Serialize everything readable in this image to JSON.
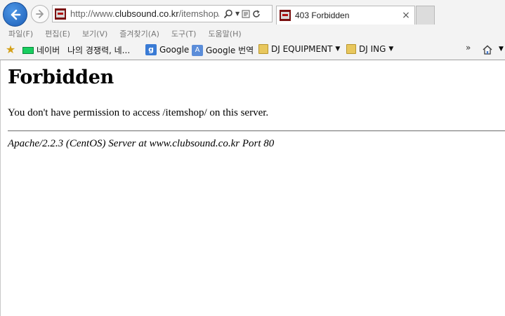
{
  "browser": {
    "address": {
      "prefix": "http://www.",
      "domain": "clubsound.co.kr",
      "path": "/itemshop/"
    },
    "tab": {
      "title": "403 Forbidden",
      "close": "×"
    },
    "menu": [
      "파일(F)",
      "편집(E)",
      "보기(V)",
      "즐겨찾기(A)",
      "도구(T)",
      "도움말(H)"
    ],
    "favorites": [
      {
        "label": "네이버",
        "icon": "naver-icon"
      },
      {
        "label": "나의 경쟁력, 네...",
        "icon": "none"
      },
      {
        "label": "Google",
        "icon": "google-icon"
      },
      {
        "label": "Google 번역",
        "icon": "google-translate-icon"
      },
      {
        "label": "DJ EQUIPMENT",
        "icon": "folder-icon",
        "dropdown": true
      },
      {
        "label": "DJ ING",
        "icon": "folder-icon",
        "dropdown": true
      }
    ],
    "overflow": "»"
  },
  "page": {
    "title": "Forbidden",
    "message": "You don't have permission to access /itemshop/ on this server.",
    "address": "Apache/2.2.3 (CentOS) Server at www.clubsound.co.kr Port 80"
  }
}
